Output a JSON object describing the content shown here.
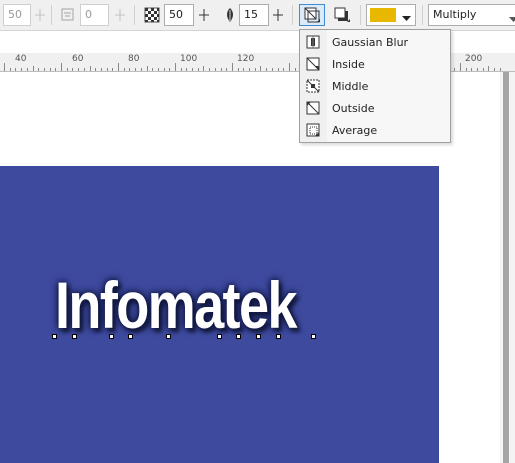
{
  "toolbar": {
    "field1_value": "50",
    "field2_value": "0",
    "opacity_value": "50",
    "feather_value": "15",
    "blend_mode": "Multiply",
    "shadow_color": "#e8b800"
  },
  "ruler": {
    "labels": [
      "40",
      "60",
      "80",
      "100",
      "120",
      "200"
    ]
  },
  "menu": {
    "items": [
      {
        "label": "Gaussian Blur",
        "icon": "gaussian-blur-icon"
      },
      {
        "label": "Inside",
        "icon": "inside-icon"
      },
      {
        "label": "Middle",
        "icon": "middle-icon"
      },
      {
        "label": "Outside",
        "icon": "outside-icon"
      },
      {
        "label": "Average",
        "icon": "average-icon"
      }
    ]
  },
  "canvas": {
    "headline": "Infomatek",
    "rect_color": "#3e4a9e"
  }
}
